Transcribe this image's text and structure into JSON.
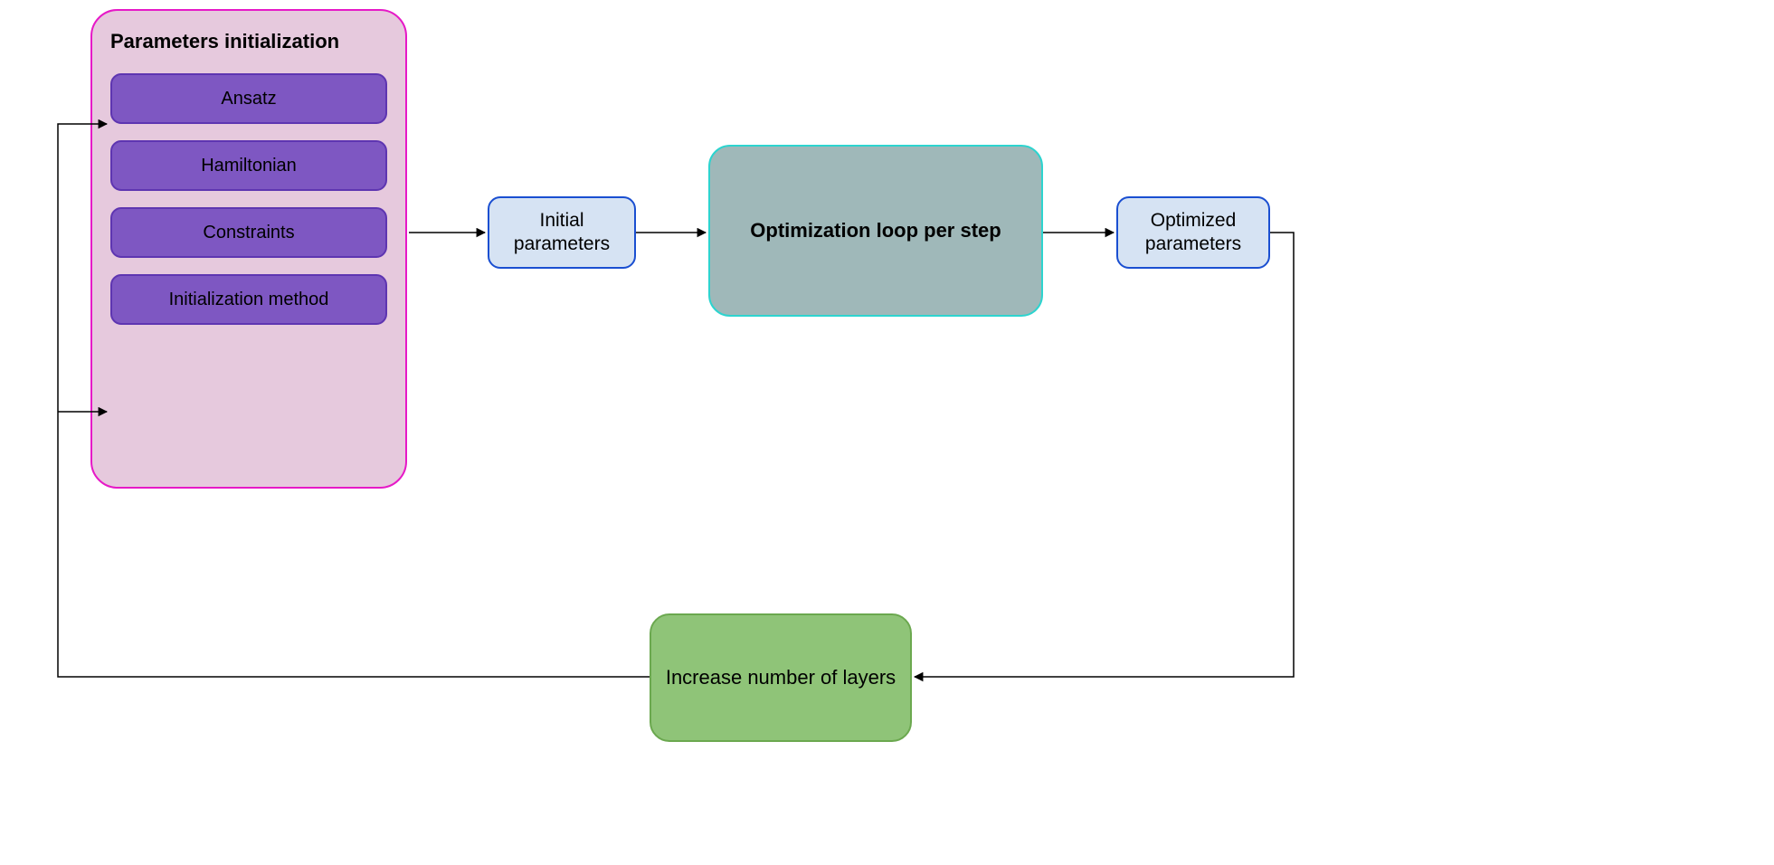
{
  "params_init": {
    "title": "Parameters initialization",
    "items": [
      "Ansatz",
      "Hamiltonian",
      "Constraints",
      "Initialization method"
    ]
  },
  "initial_params": "Initial parameters",
  "opt_loop": "Optimization loop per step",
  "optimized_params": "Optimized parameters",
  "increase_layers": "Increase number of layers"
}
